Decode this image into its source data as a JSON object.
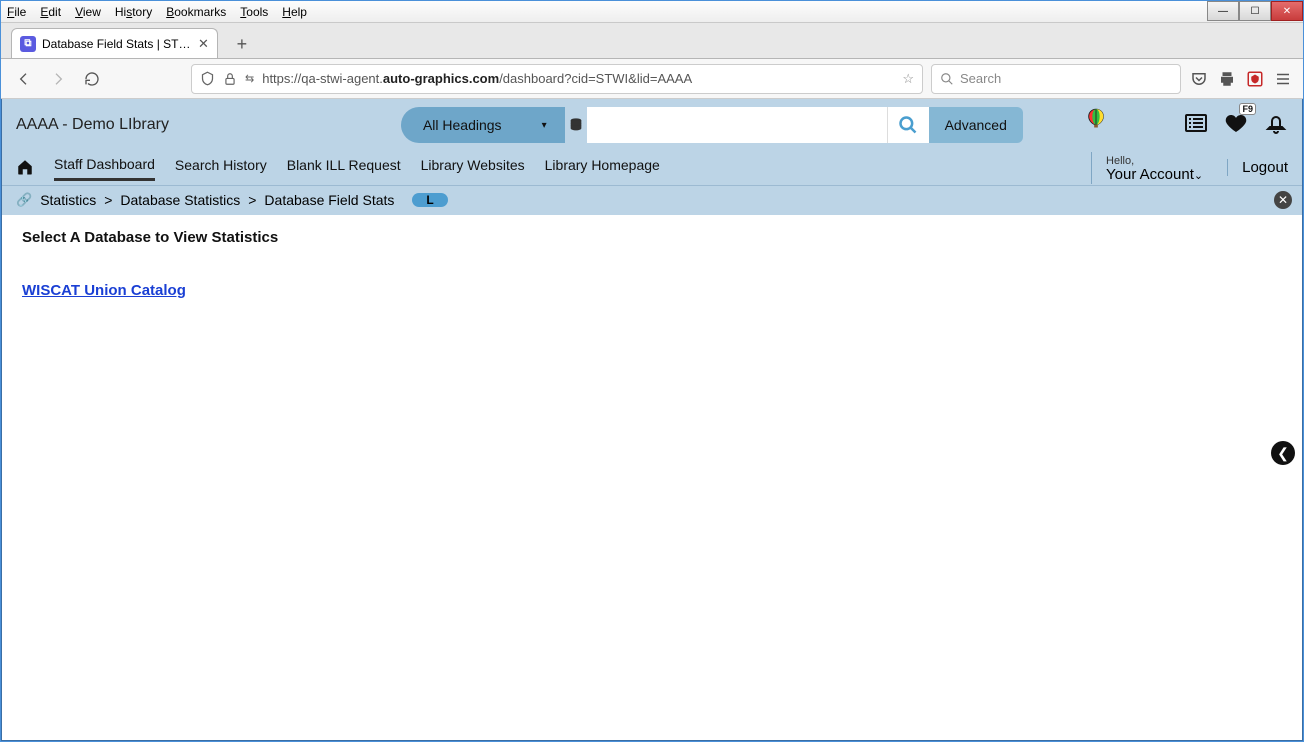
{
  "browser": {
    "menu": [
      "File",
      "Edit",
      "View",
      "History",
      "Bookmarks",
      "Tools",
      "Help"
    ],
    "tab_title": "Database Field Stats | STWI | aaa",
    "url_prefix": "https://qa-stwi-agent.",
    "url_bold": "auto-graphics.com",
    "url_suffix": "/dashboard?cid=STWI&lid=AAAA",
    "search_placeholder": "Search"
  },
  "app": {
    "library_title": "AAAA - Demo LIbrary",
    "dropdown_label": "All Headings",
    "advanced_label": "Advanced",
    "heart_badge": "F9",
    "nav": {
      "staff_dashboard": "Staff Dashboard",
      "search_history": "Search History",
      "blank_ill": "Blank ILL Request",
      "library_websites": "Library Websites",
      "library_homepage": "Library Homepage"
    },
    "account": {
      "hello": "Hello,",
      "your_account": "Your Account",
      "logout": "Logout"
    },
    "breadcrumb": {
      "a": "Statistics",
      "b": "Database Statistics",
      "c": "Database Field Stats",
      "pill": "L"
    },
    "content": {
      "heading": "Select A Database to View Statistics",
      "db_link": "WISCAT Union Catalog"
    }
  }
}
